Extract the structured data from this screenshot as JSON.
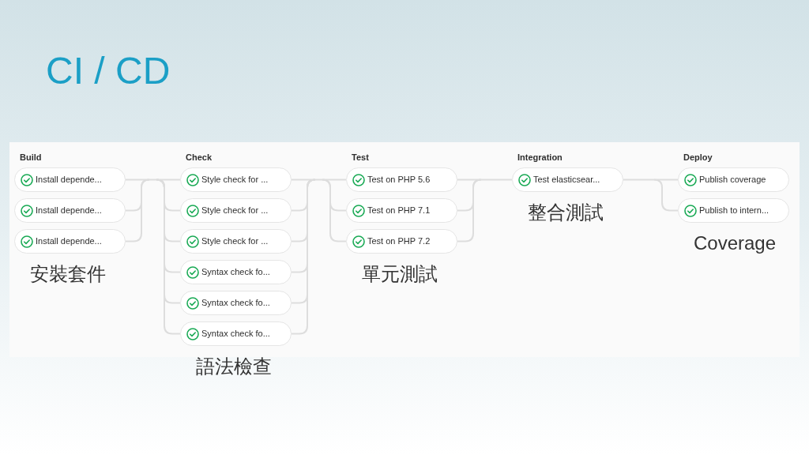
{
  "slide": {
    "title": "CI / CD"
  },
  "stages": [
    {
      "name": "Build",
      "jobs": [
        {
          "label": "Install depende...",
          "kind": "passed"
        },
        {
          "label": "Install depende...",
          "kind": "passed"
        },
        {
          "label": "Install depende...",
          "kind": "passed"
        }
      ],
      "note": "安裝套件"
    },
    {
      "name": "Check",
      "jobs": [
        {
          "label": "Style check for ...",
          "kind": "passed"
        },
        {
          "label": "Style check for ...",
          "kind": "passed"
        },
        {
          "label": "Style check for ...",
          "kind": "passed"
        },
        {
          "label": "Syntax check fo...",
          "kind": "passed"
        },
        {
          "label": "Syntax check fo...",
          "kind": "passed"
        },
        {
          "label": "Syntax check fo...",
          "kind": "passed"
        }
      ],
      "note": "語法檢查"
    },
    {
      "name": "Test",
      "jobs": [
        {
          "label": "Test on PHP 5.6",
          "kind": "passed"
        },
        {
          "label": "Test on PHP 7.1",
          "kind": "passed"
        },
        {
          "label": "Test on PHP 7.2",
          "kind": "passed"
        }
      ],
      "note": "單元測試"
    },
    {
      "name": "Integration",
      "jobs": [
        {
          "label": "Test elasticsear...",
          "kind": "passed"
        }
      ],
      "note": "整合測試"
    },
    {
      "name": "Deploy",
      "jobs": [
        {
          "label": "Publish coverage",
          "kind": "passed"
        },
        {
          "label": "Publish to intern...",
          "kind": "passed"
        }
      ],
      "note": "Coverage"
    }
  ]
}
